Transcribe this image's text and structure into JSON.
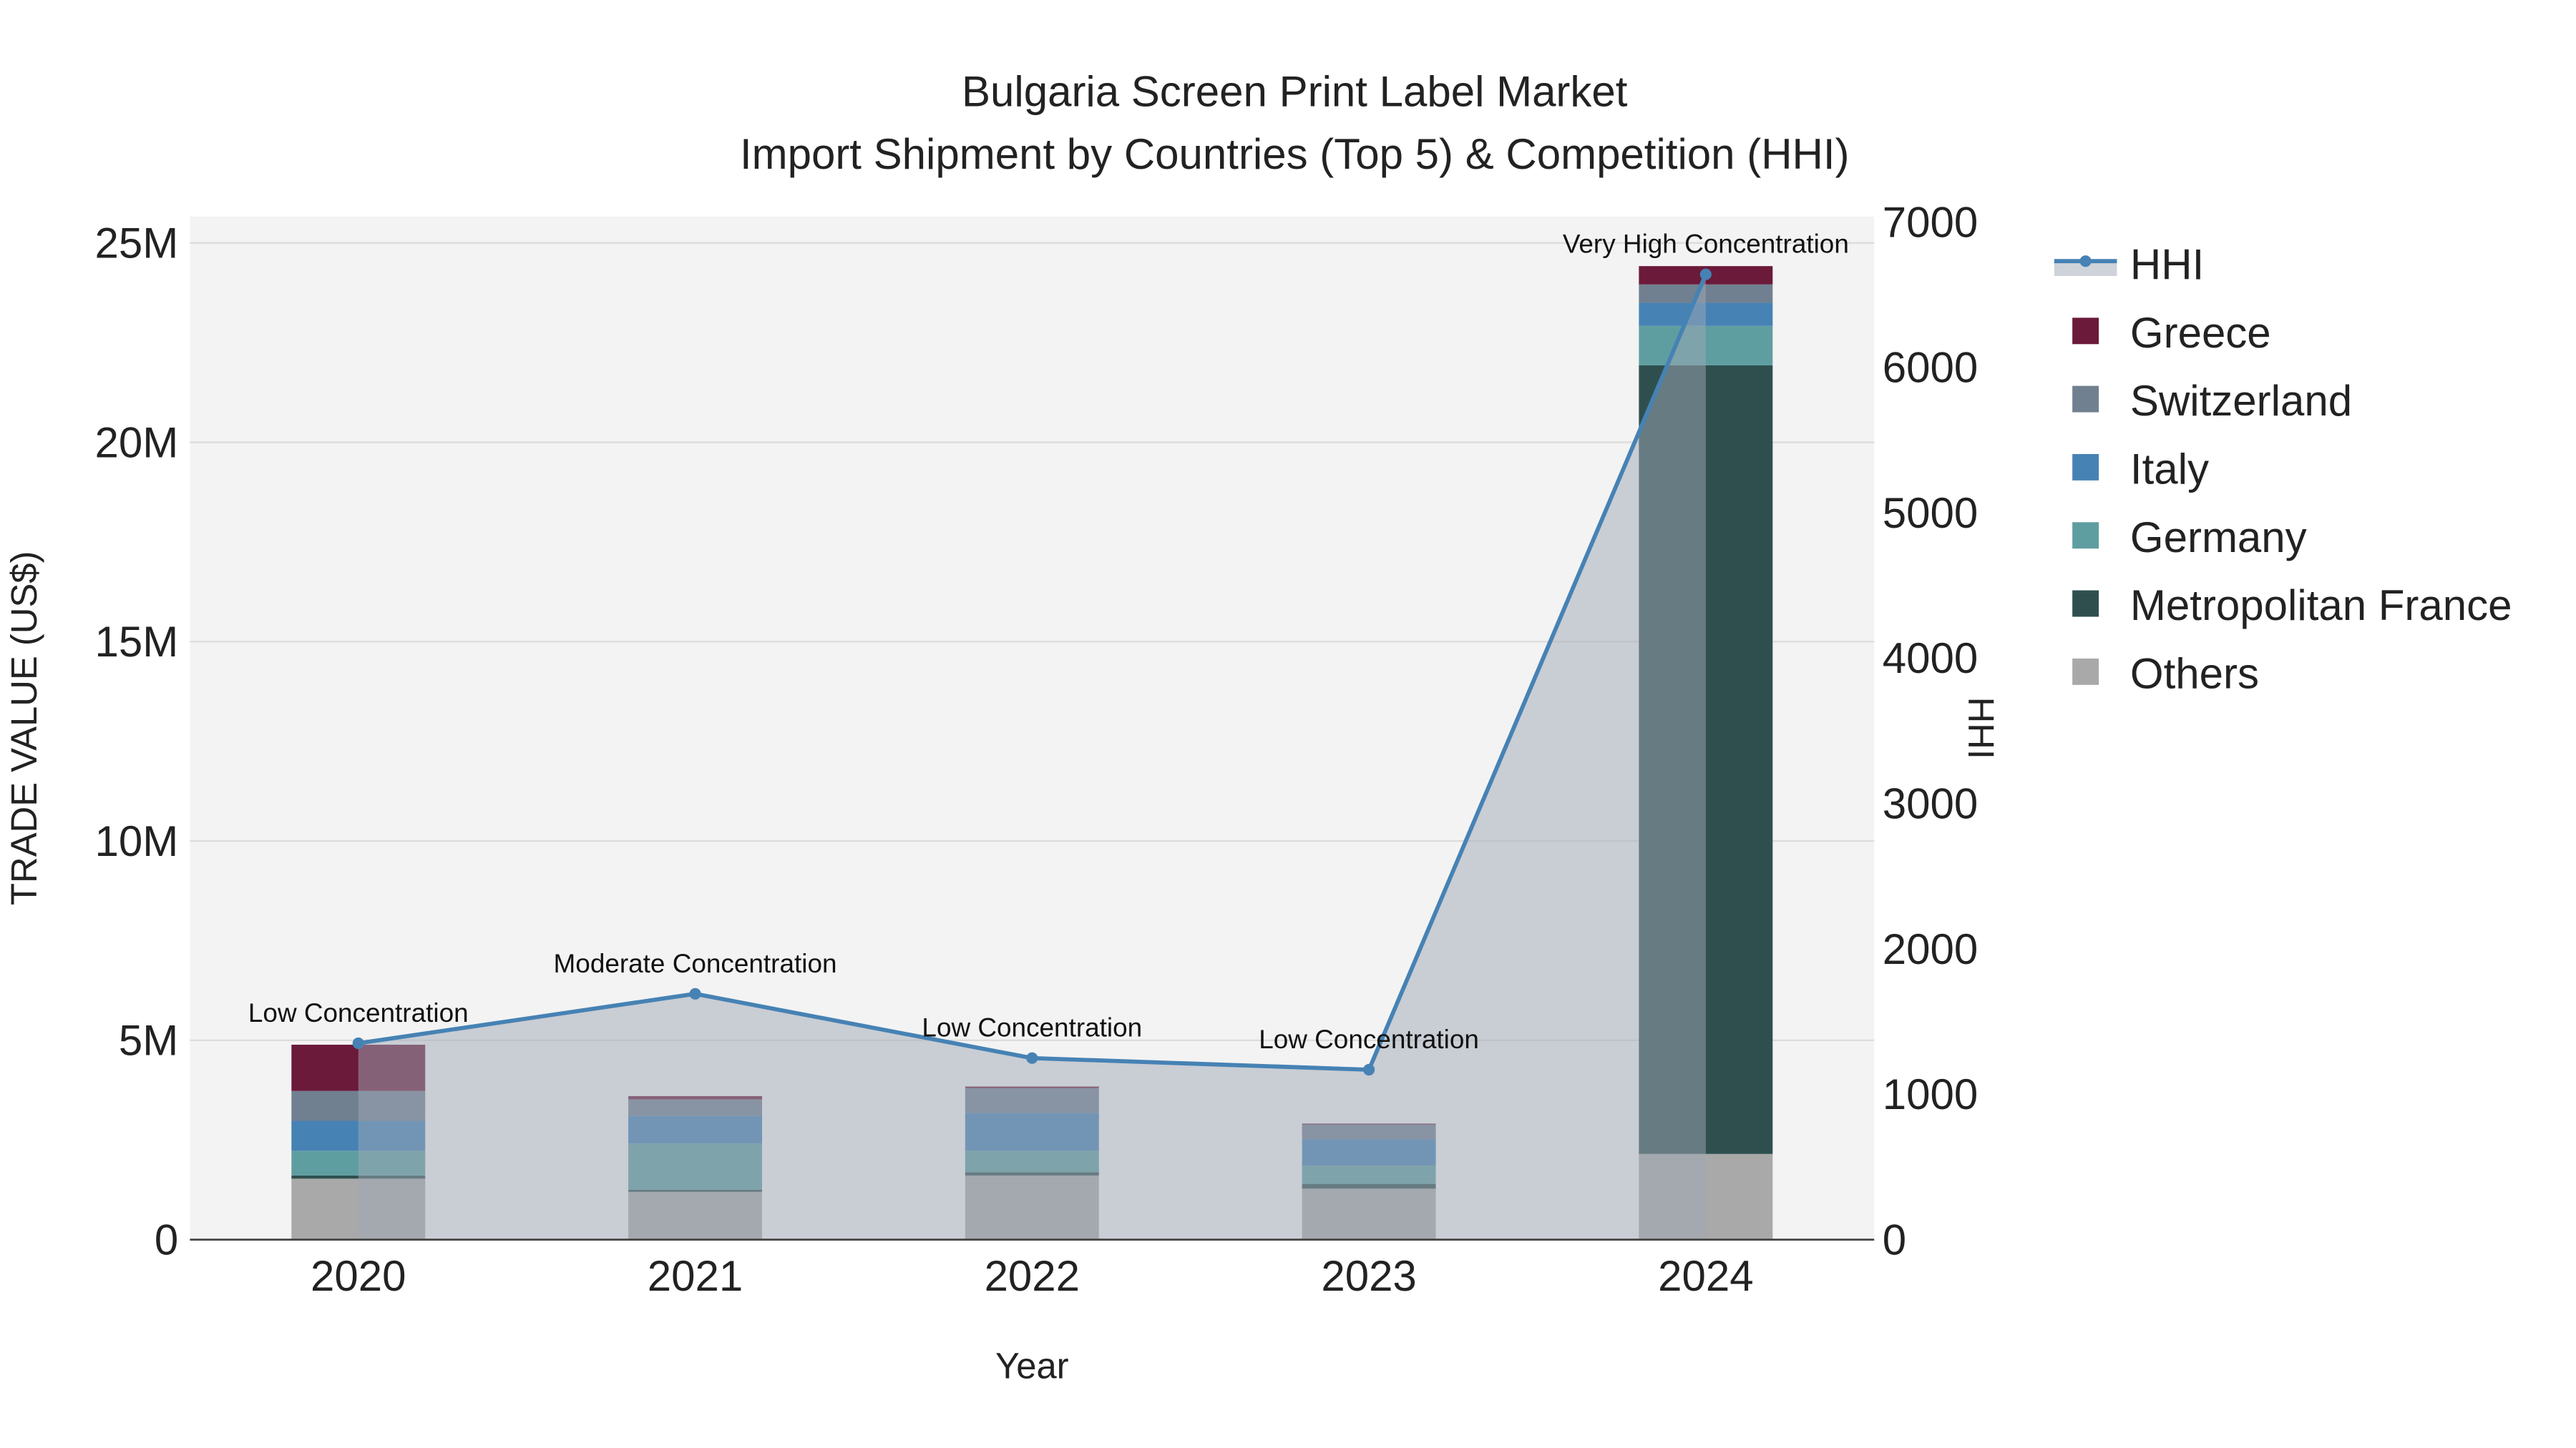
{
  "chart_data": {
    "type": "bar",
    "title": "Bulgaria Screen Print Label Market",
    "subtitle": "Import Shipment by Countries (Top 5) & Competition (HHI)",
    "xlabel": "Year",
    "ylabel": "TRADE VALUE (US$)",
    "y2label": "HHI",
    "categories": [
      "2020",
      "2021",
      "2022",
      "2023",
      "2024"
    ],
    "ylim": [
      0,
      25600000
    ],
    "y2lim": [
      0,
      7000
    ],
    "yticks": [
      {
        "v": 0,
        "label": "0"
      },
      {
        "v": 5000000,
        "label": "5M"
      },
      {
        "v": 10000000,
        "label": "10M"
      },
      {
        "v": 15000000,
        "label": "15M"
      },
      {
        "v": 20000000,
        "label": "20M"
      },
      {
        "v": 25000000,
        "label": "25M"
      }
    ],
    "y2ticks": [
      {
        "v": 0,
        "label": "0"
      },
      {
        "v": 1000,
        "label": "1000"
      },
      {
        "v": 2000,
        "label": "2000"
      },
      {
        "v": 3000,
        "label": "3000"
      },
      {
        "v": 4000,
        "label": "4000"
      },
      {
        "v": 5000,
        "label": "5000"
      },
      {
        "v": 6000,
        "label": "6000"
      },
      {
        "v": 7000,
        "label": "7000"
      }
    ],
    "grid": true,
    "legend_placement": "right",
    "series": [
      {
        "name": "Others",
        "color": "#a9a9a9",
        "values": [
          1530000,
          1200000,
          1610000,
          1280000,
          2150000
        ]
      },
      {
        "name": "Metropolitan France",
        "color": "#2f4f4f",
        "values": [
          80000,
          50000,
          80000,
          120000,
          19780000
        ]
      },
      {
        "name": "Germany",
        "color": "#5f9ea0",
        "values": [
          620000,
          1160000,
          540000,
          460000,
          990000
        ]
      },
      {
        "name": "Italy",
        "color": "#4682b4",
        "values": [
          750000,
          700000,
          950000,
          660000,
          580000
        ]
      },
      {
        "name": "Switzerland",
        "color": "#708090",
        "values": [
          750000,
          410000,
          620000,
          370000,
          460000
        ]
      },
      {
        "name": "Greece",
        "color": "#6b1a3a",
        "values": [
          1160000,
          80000,
          40000,
          20000,
          460000
        ]
      }
    ],
    "hhi": {
      "name": "HHI",
      "color": "#4682b4",
      "values": [
        1351,
        1691,
        1249,
        1169,
        6640
      ],
      "annotations": [
        "Low Concentration",
        "Moderate Concentration",
        "Low Concentration",
        "Low Concentration",
        "Very High Concentration"
      ]
    },
    "legend": [
      "HHI",
      "Greece",
      "Switzerland",
      "Italy",
      "Germany",
      "Metropolitan France",
      "Others"
    ]
  }
}
